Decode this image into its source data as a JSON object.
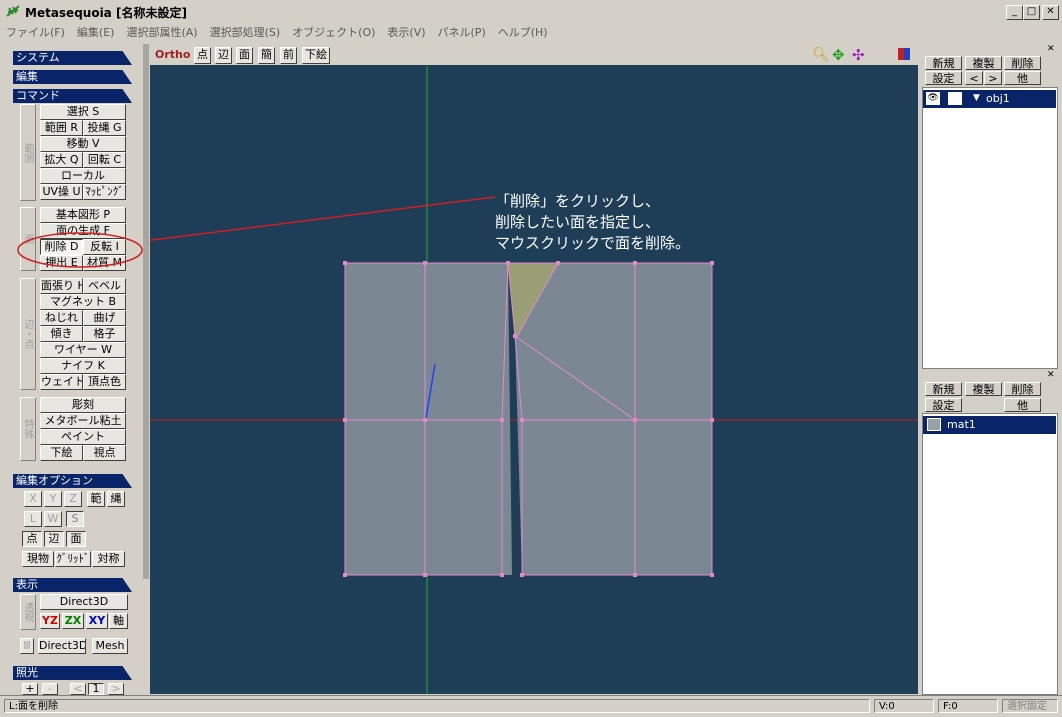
{
  "window": {
    "title": "Metasequoia [名称未設定]"
  },
  "menu": [
    "ファイル(F)",
    "編集(E)",
    "選択部属性(A)",
    "選択部処理(S)",
    "オブジェクト(O)",
    "表示(V)",
    "パネル(P)",
    "ヘルプ(H)"
  ],
  "left": {
    "system": "システム",
    "edit": "編集",
    "command": "コマンド",
    "group_hanni": "範囲",
    "group_men": "面",
    "group_hen": "辺・点",
    "group_tokushu": "特殊",
    "btn_select": "選択 S",
    "btn_range": "範囲 R",
    "btn_lasso": "投縄 G",
    "btn_move": "移動 V",
    "btn_scale": "拡大 Q",
    "btn_rotate": "回転 C",
    "btn_local": "ローカル",
    "btn_uv": "UV操 U",
    "btn_mapping": "ﾏｯﾋﾟﾝｸﾞ",
    "btn_basic": "基本図形 P",
    "btn_genface": "面の生成 F",
    "btn_delete": "削除 D",
    "btn_flip": "反転 I",
    "btn_extrude": "押出 E",
    "btn_material": "材質 M",
    "btn_faceh": "面張り H",
    "btn_bevel": "ベベル",
    "btn_magnet": "マグネット B",
    "btn_twist": "ねじれ",
    "btn_bend": "曲げ",
    "btn_tilt": "傾き",
    "btn_lattice": "格子",
    "btn_wire": "ワイヤー W",
    "btn_knife": "ナイフ K",
    "btn_weight": "ウェイト",
    "btn_vcolor": "頂点色",
    "btn_sculpt": "彫刻",
    "btn_metaball": "メタボール粘土",
    "btn_paint": "ペイント",
    "btn_underlay": "下絵",
    "btn_viewpoint": "視点",
    "editopt": "編集オプション",
    "opt_x": "X",
    "opt_y": "Y",
    "opt_z": "Z",
    "opt_range": "範",
    "opt_lasso": "縄",
    "opt_l": "L",
    "opt_w": "W",
    "opt_s": "S",
    "opt_pt": "点",
    "opt_edge": "辺",
    "opt_face": "面",
    "opt_current": "現物",
    "opt_grid": "ｸﾞﾘｯﾄﾞ",
    "opt_sym": "対称",
    "display": "表示",
    "disp_persp": "透視",
    "disp_d3d": "Direct3D",
    "disp_yz": "YZ",
    "disp_zx": "ZX",
    "disp_xy": "XY",
    "disp_axis": "軸",
    "disp_d3d2": "Direct3D",
    "disp_mesh": "Mesh",
    "light": "照光",
    "light_plus": "+",
    "light_minus": "-",
    "light_prev": "<",
    "light_num": "1",
    "light_next": ">"
  },
  "viewport": {
    "mode": "Ortho",
    "tb_pt": "点",
    "tb_edge": "辺",
    "tb_face": "面",
    "tb_simple": "簡",
    "tb_front": "前",
    "tb_underlay": "下絵",
    "annotation": [
      "「削除」をクリックし、",
      "削除したい面を指定し、",
      "マウスクリックで面を削除。"
    ]
  },
  "objpanel": {
    "new": "新規",
    "dup": "複製",
    "del": "削除",
    "settings": "設定",
    "prev": "<",
    "next": ">",
    "other": "他",
    "object_name": "obj1"
  },
  "matpanel": {
    "new": "新規",
    "dup": "複製",
    "del": "削除",
    "settings": "設定",
    "other": "他",
    "material_name": "mat1"
  },
  "status": {
    "hint": "L:面を削除",
    "v": "V:0",
    "f": "F:0",
    "mode": "選択固定"
  },
  "colors": {
    "viewport_bg": "#1e3d57",
    "selection": "#0a246a",
    "mesh_fill": "#7b8894",
    "edge": "#e58ac8",
    "annot_line": "#d02020"
  }
}
